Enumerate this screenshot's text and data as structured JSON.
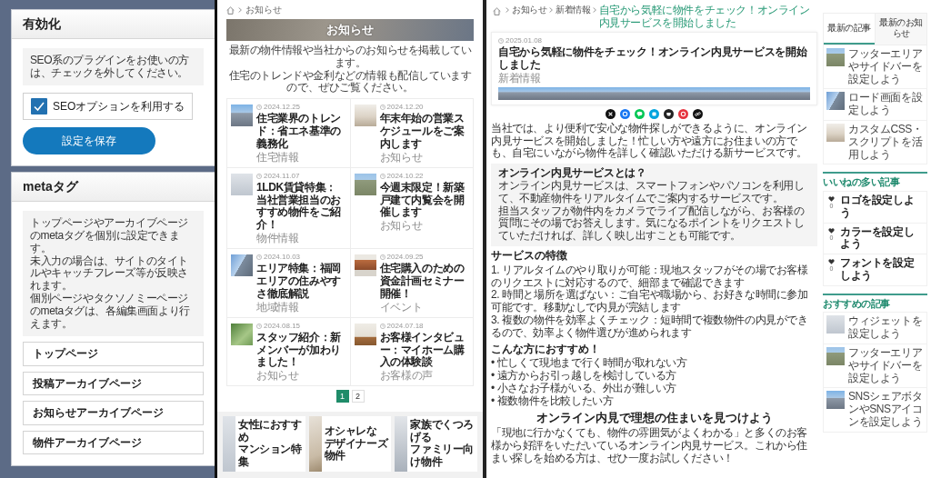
{
  "settings": {
    "sections": [
      {
        "title": "有効化",
        "notes": [
          "SEO系のプラグインをお使いの方は、チェックを外してください。"
        ],
        "checkbox": {
          "label": "SEOオプションを利用する",
          "checked": true
        },
        "save_button": "設定を保存"
      },
      {
        "title": "metaタグ",
        "notes": [
          "トップページやアーカイブページのmetaタグを個別に設定できます。",
          "未入力の場合は、サイトのタイトルやキャッチフレーズ等が反映されます。",
          "個別ページやタクソノミーページのmetaタグは、各編集画面より行えます。"
        ],
        "accordion": [
          "トップページ",
          "投稿アーカイブページ",
          "お知らせアーカイブページ",
          "物件アーカイブページ"
        ]
      }
    ]
  },
  "news_page": {
    "breadcrumb": [
      "お知らせ"
    ],
    "hero_title": "お知らせ",
    "intro": [
      "最新の物件情報や当社からのお知らせを掲載しています。",
      "住宅のトレンドや金利などの情報も配信していますので、ぜひご覧ください。"
    ],
    "posts": [
      {
        "date": "2024.12.25",
        "title": "住宅業界のトレンド：省エネ基準の義務化",
        "category": "住宅情報"
      },
      {
        "date": "2024.12.20",
        "title": "年末年始の営業スケジュールをご案内します",
        "category": "お知らせ"
      },
      {
        "date": "2024.11.07",
        "title": "1LDK賃貸特集：当社営業担当のおすすめ物件をご紹介！",
        "category": "物件情報"
      },
      {
        "date": "2024.10.22",
        "title": "今週末限定！新築戸建て内覧会を開催します",
        "category": "お知らせ"
      },
      {
        "date": "2024.10.03",
        "title": "エリア特集：福岡エリアの住みやすさ徹底解説",
        "category": "地域情報"
      },
      {
        "date": "2024.09.25",
        "title": "住宅購入のための資金計画セミナー開催！",
        "category": "イベント"
      },
      {
        "date": "2024.08.15",
        "title": "スタッフ紹介：新メンバーが加わりました！",
        "category": "お知らせ"
      },
      {
        "date": "2024.07.18",
        "title": "お客様インタビュー：マイホーム購入の体験談",
        "category": "お客様の声"
      }
    ],
    "pagination": [
      {
        "label": "1",
        "selected": true
      },
      {
        "label": "2",
        "selected": false
      }
    ],
    "banners": [
      {
        "lines": [
          "女性におすすめ",
          "マンション特集"
        ]
      },
      {
        "lines": [
          "オシャレな",
          "デザイナーズ物件"
        ]
      },
      {
        "lines": [
          "家族でくつろげる",
          "ファミリー向け物件"
        ]
      }
    ]
  },
  "article_page": {
    "breadcrumb": [
      {
        "label": "お知らせ",
        "kind": "link"
      },
      {
        "label": "新着情報",
        "kind": "link"
      },
      {
        "label": "自宅から気軽に物件をチェック！オンライン内見サービスを開始しました",
        "kind": "current"
      }
    ],
    "date": "2025.01.08",
    "title": "自宅から気軽に物件をチェック！オンライン内見サービスを開始しました",
    "category": "新着情報",
    "body": [
      {
        "kind": "paragraph",
        "text": "当社では、より便利で安心な物件探しができるように、オンライン内見サービスを開始しました！忙しい方や遠方にお住まいの方でも、自宅にいながら物件を詳しく確認いただける新サービスです。"
      },
      {
        "kind": "box",
        "title": "オンライン内見サービスとは？",
        "lines": [
          "オンライン内見サービスは、スマートフォンやパソコンを利用して、不動産物件をリアルタイムでご案内するサービスです。",
          "担当スタッフが物件内をカメラでライブ配信しながら、お客様の質問にその場でお答えします。気になるポイントをリクエストしていただければ、詳しく映し出すことも可能です。"
        ]
      },
      {
        "kind": "heading",
        "text": "サービスの特徴"
      },
      {
        "kind": "list",
        "items": [
          "1. リアルタイムのやり取りが可能：現地スタッフがその場でお客様のリクエストに対応するので、細部まで確認できます",
          "2. 時間と場所を選ばない：ご自宅や職場から、お好きな時間に参加可能です。移動なしで内見が完結します",
          "3. 複数の物件を効率よくチェック：短時間で複数物件の内見ができるので、効率よく物件選びが進められます"
        ]
      },
      {
        "kind": "heading",
        "text": "こんな方におすすめ！"
      },
      {
        "kind": "list",
        "items": [
          "• 忙しくて現地まで行く時間が取れない方",
          "• 遠方からお引っ越しを検討している方",
          "• 小さなお子様がいる、外出が難しい方",
          "• 複数物件を比較したい方"
        ]
      },
      {
        "kind": "centered_heading",
        "text": "オンライン内見で理想の住まいを見つけよう"
      },
      {
        "kind": "paragraph",
        "text": "「現地に行かなくても、物件の雰囲気がよくわかる」と多くのお客様から好評をいただいているオンライン内見サービス。これから住まい探しを始める方は、ぜひ一度お試しください！"
      }
    ],
    "sidebar": {
      "tabs": [
        {
          "label": "最新の記事",
          "selected": true
        },
        {
          "label": "最新のお知らせ",
          "selected": false
        }
      ],
      "tab_posts": [
        "フッターエリアやサイドバーを設定しよう",
        "ロード画面を設定しよう",
        "カスタムCSS・スクリプトを活用しよう"
      ],
      "widgets": [
        {
          "kind": "liked",
          "title": "いいねの多い記事",
          "posts": [
            {
              "title": "ロゴを設定しよう",
              "count": "0"
            },
            {
              "title": "カラーを設定しよう",
              "count": "0"
            },
            {
              "title": "フォントを設定しよう",
              "count": "0"
            }
          ]
        },
        {
          "kind": "thumbs",
          "title": "おすすめの記事",
          "posts": [
            {
              "title": "ウィジェットを設定しよう"
            },
            {
              "title": "フッターエリアやサイドバーを設定しよう"
            },
            {
              "title": "SNSシェアボタンやSNSアイコンを設定しよう"
            }
          ]
        }
      ]
    }
  }
}
